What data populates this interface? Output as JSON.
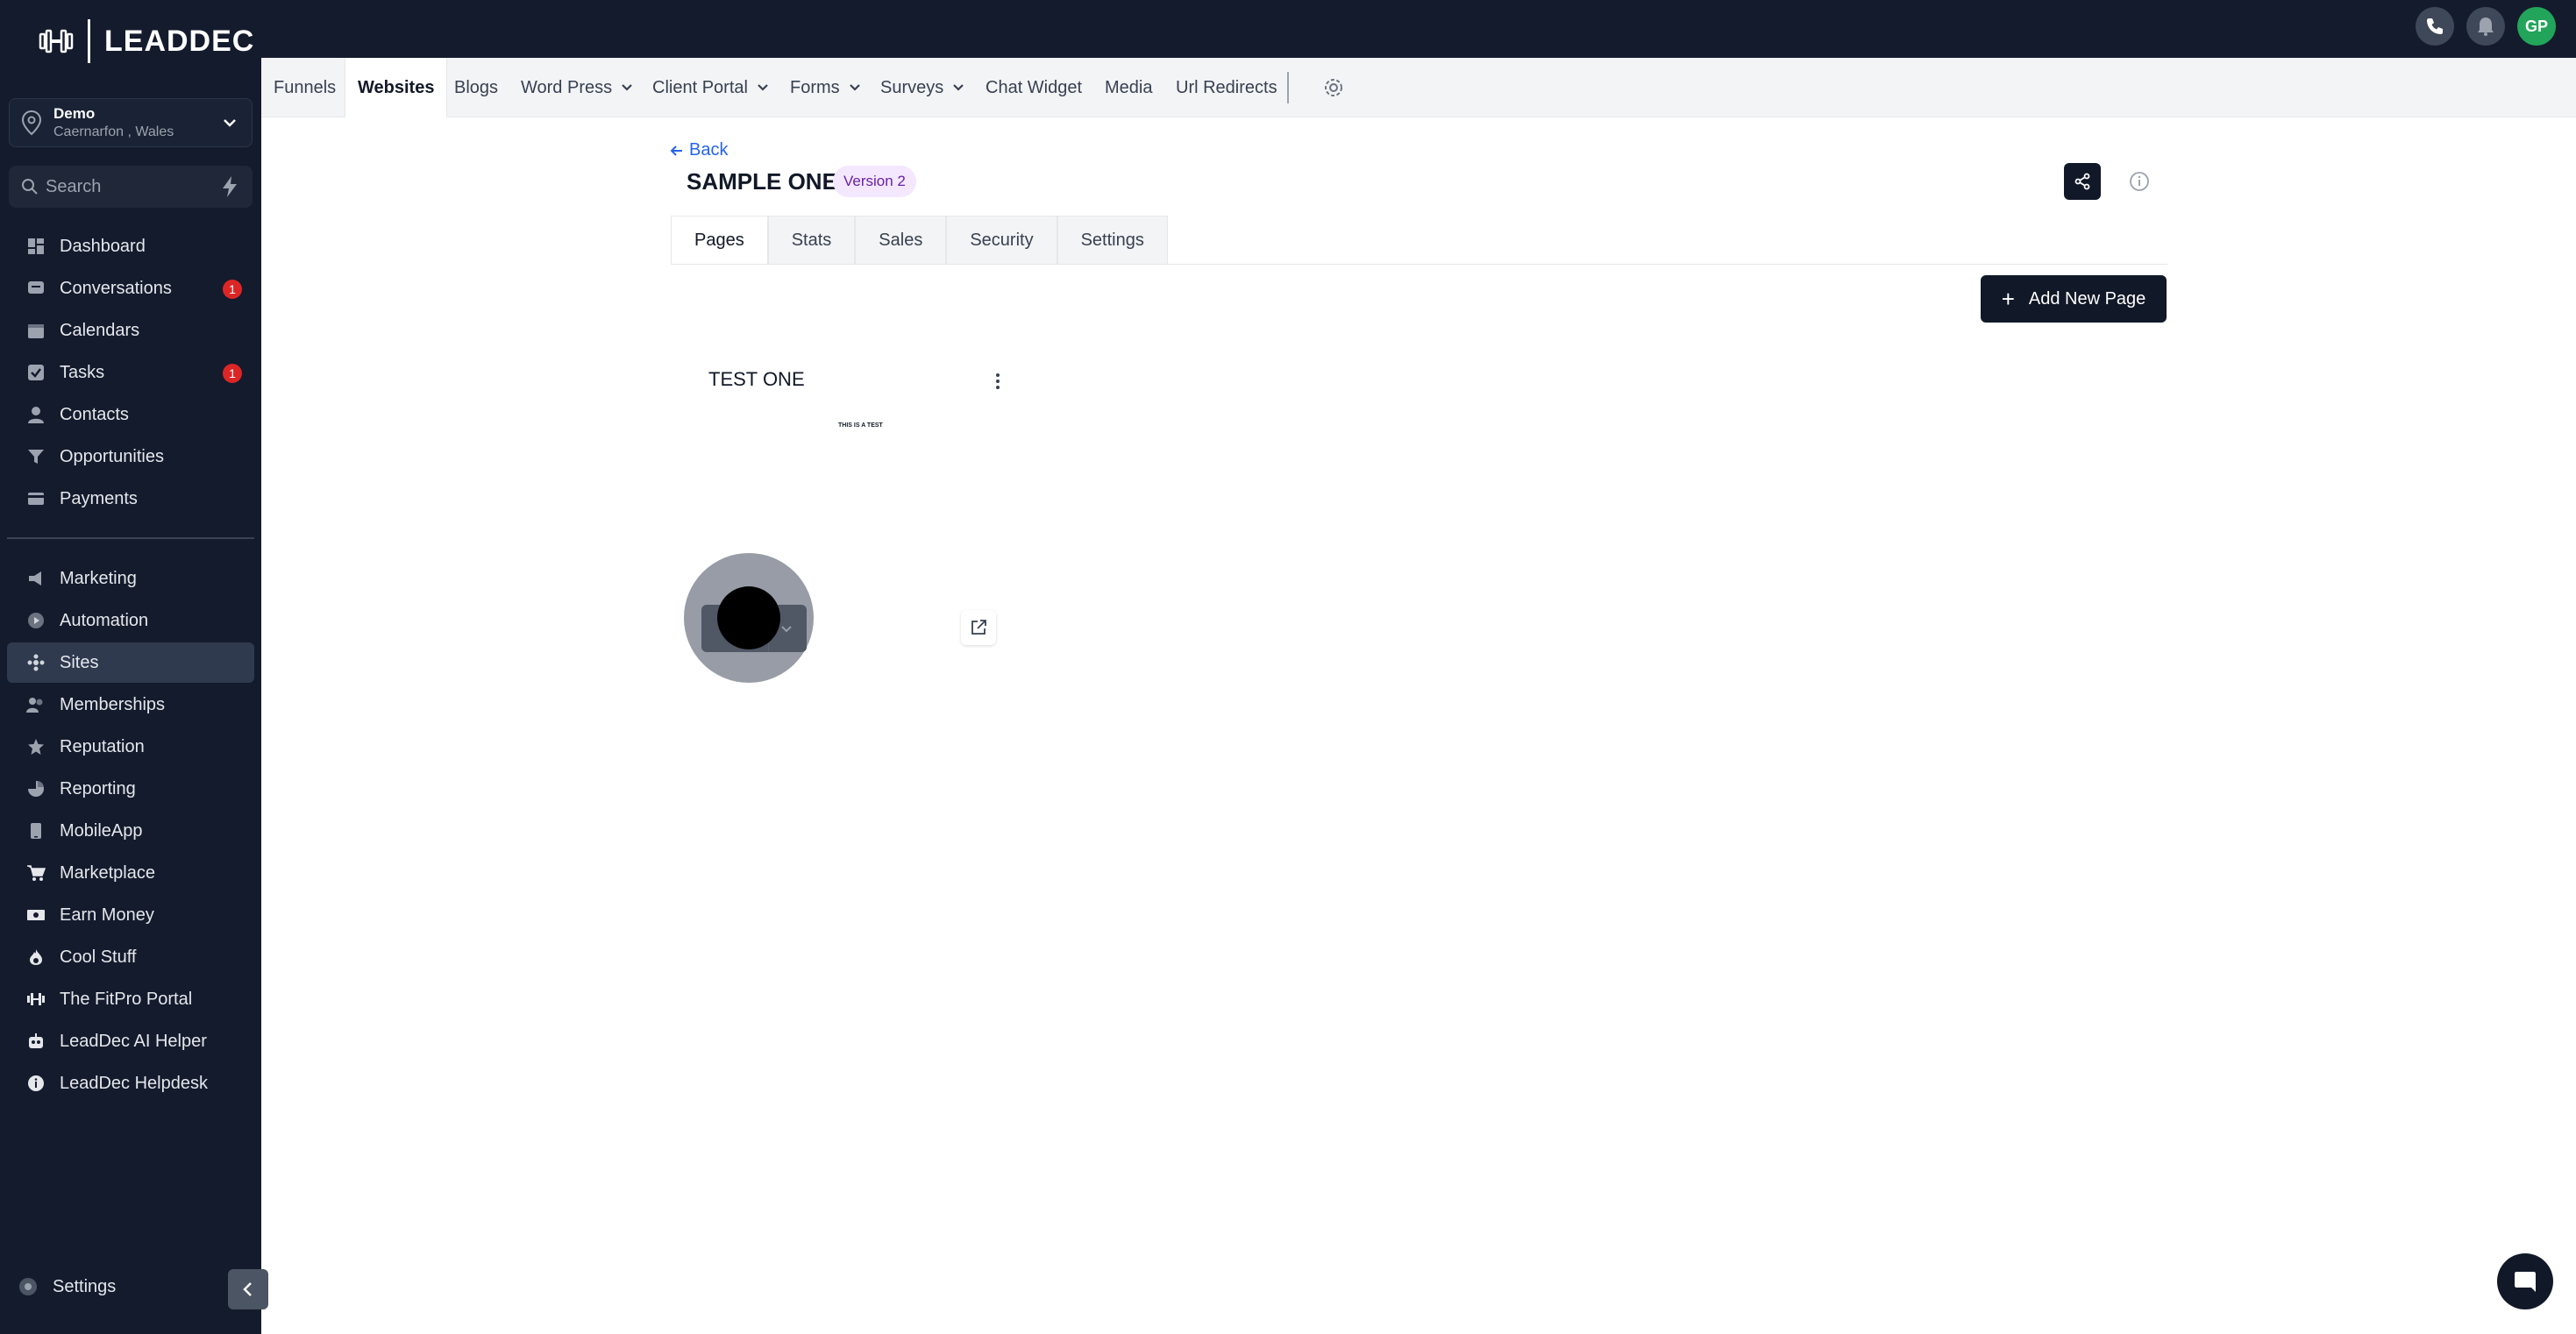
{
  "brand": {
    "name": "LEADDEC"
  },
  "account": {
    "name": "Demo",
    "location": "Caernarfon , Wales"
  },
  "search": {
    "placeholder": "Search"
  },
  "sidebar": {
    "items": [
      {
        "label": "Dashboard",
        "icon": "dashboard-icon"
      },
      {
        "label": "Conversations",
        "icon": "chat-icon",
        "badge": "1"
      },
      {
        "label": "Calendars",
        "icon": "calendar-icon"
      },
      {
        "label": "Tasks",
        "icon": "check-icon",
        "badge": "1"
      },
      {
        "label": "Contacts",
        "icon": "person-icon"
      },
      {
        "label": "Opportunities",
        "icon": "funnel-icon"
      },
      {
        "label": "Payments",
        "icon": "card-icon"
      },
      {
        "label": "Marketing",
        "icon": "megaphone-icon"
      },
      {
        "label": "Automation",
        "icon": "play-icon"
      },
      {
        "label": "Sites",
        "icon": "sitemap-icon",
        "active": true
      },
      {
        "label": "Memberships",
        "icon": "users-icon"
      },
      {
        "label": "Reputation",
        "icon": "star-icon"
      },
      {
        "label": "Reporting",
        "icon": "chart-icon"
      },
      {
        "label": "MobileApp",
        "icon": "phone-icon"
      },
      {
        "label": "Marketplace",
        "icon": "cart-icon"
      },
      {
        "label": "Earn Money",
        "icon": "money-icon"
      },
      {
        "label": "Cool Stuff",
        "icon": "flame-icon"
      },
      {
        "label": "The FitPro Portal",
        "icon": "dumbbell-icon"
      },
      {
        "label": "LeadDec AI Helper",
        "icon": "robot-icon"
      },
      {
        "label": "LeadDec Helpdesk",
        "icon": "info-icon"
      }
    ],
    "settings_label": "Settings"
  },
  "topbar": {
    "avatar_initials": "GP"
  },
  "subnav": {
    "items": [
      {
        "label": "Funnels"
      },
      {
        "label": "Websites",
        "active": true
      },
      {
        "label": "Blogs"
      },
      {
        "label": "Word Press",
        "dropdown": true
      },
      {
        "label": "Client Portal",
        "dropdown": true
      },
      {
        "label": "Forms",
        "dropdown": true
      },
      {
        "label": "Surveys",
        "dropdown": true
      },
      {
        "label": "Chat Widget"
      },
      {
        "label": "Media"
      },
      {
        "label": "Url Redirects"
      }
    ]
  },
  "main": {
    "back_label": "Back",
    "title": "SAMPLE ONE",
    "version_badge": "Version 2",
    "tabs": [
      {
        "label": "Pages",
        "active": true
      },
      {
        "label": "Stats"
      },
      {
        "label": "Sales"
      },
      {
        "label": "Security"
      },
      {
        "label": "Settings"
      }
    ],
    "add_page_label": "Add New Page",
    "page_card": {
      "title": "TEST ONE",
      "thumbnail_text": "THIS IS A TEST"
    }
  },
  "colors": {
    "sidebar_bg": "#141b2d",
    "accent_dark": "#111827",
    "badge_red": "#dc2626",
    "avatar_green": "#22a55a",
    "link_blue": "#2563eb",
    "version_purple": "#6b21a8"
  }
}
